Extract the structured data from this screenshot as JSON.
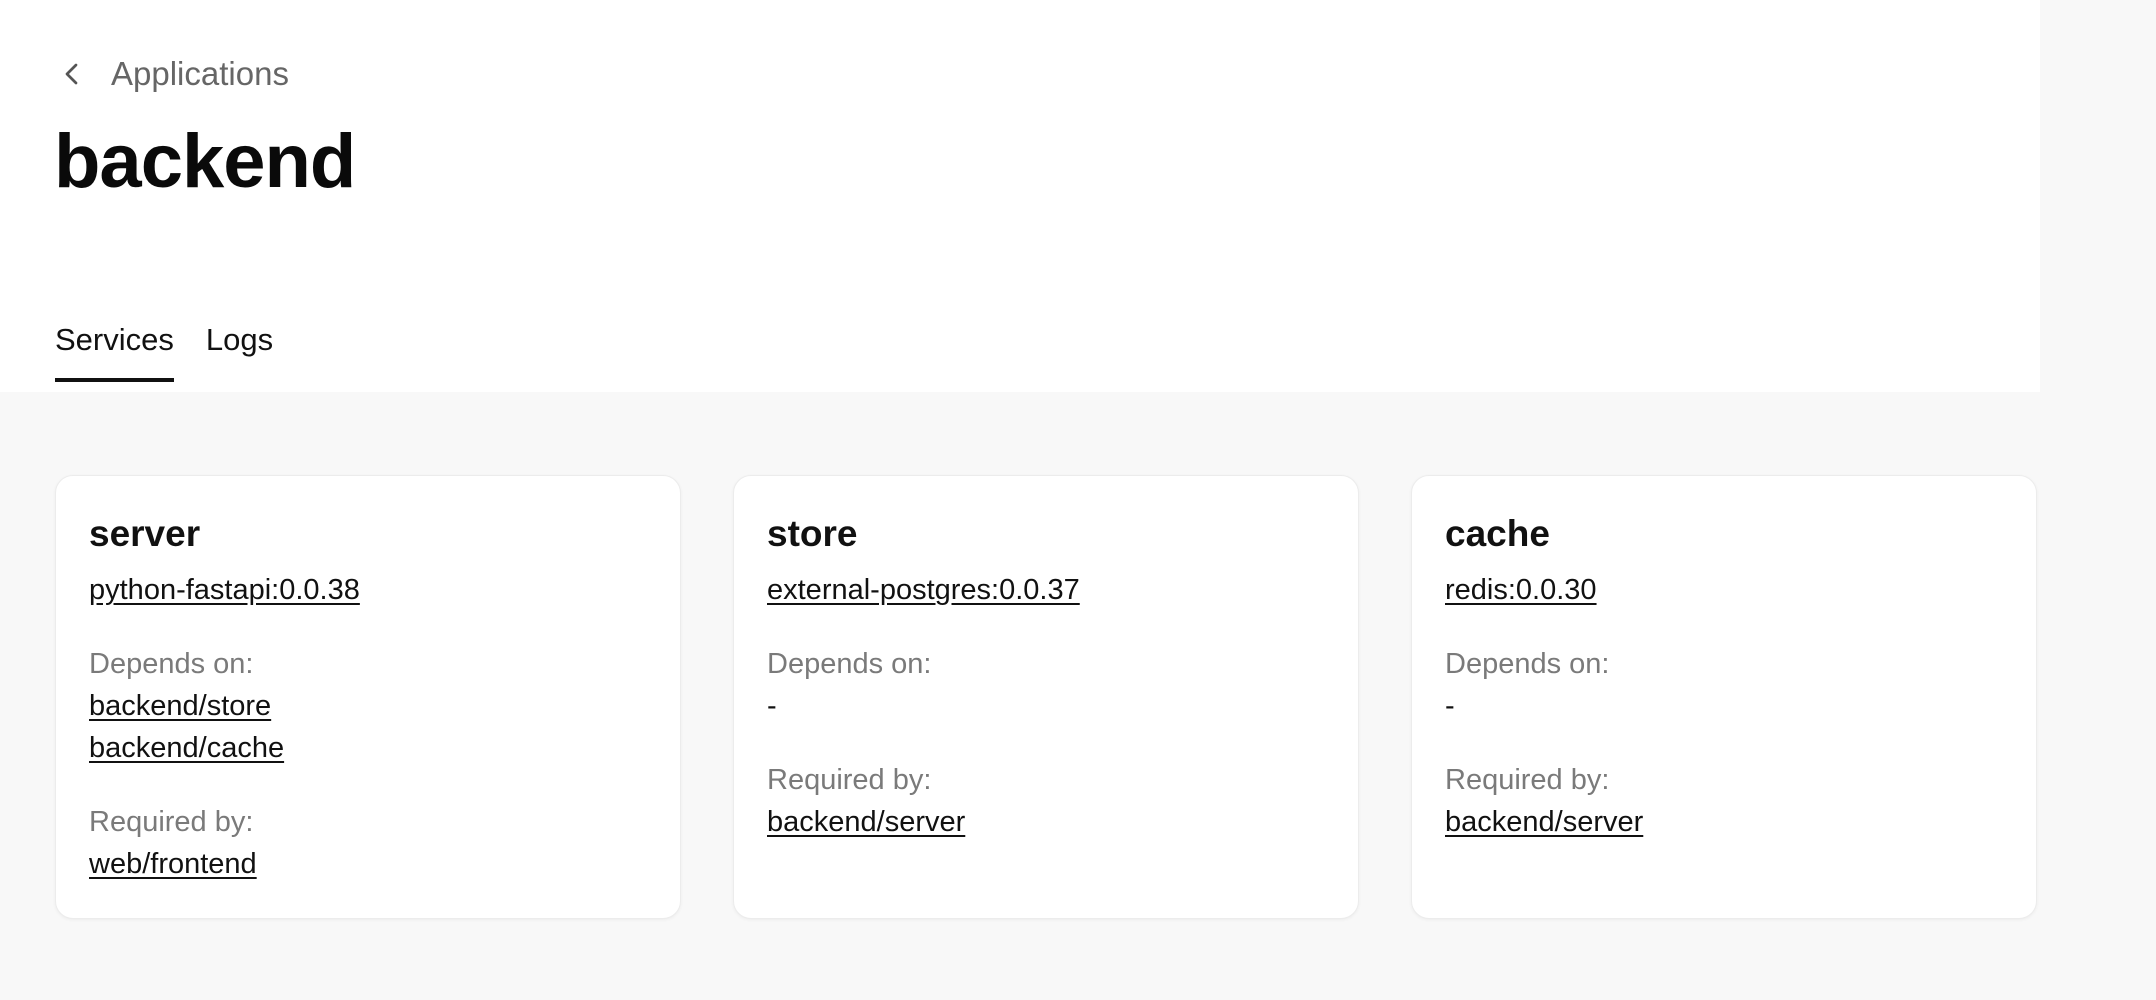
{
  "breadcrumb": {
    "label": "Applications"
  },
  "page": {
    "title": "backend"
  },
  "tabs": [
    {
      "label": "Services",
      "active": true
    },
    {
      "label": "Logs",
      "active": false
    }
  ],
  "labels": {
    "depends_on": "Depends on:",
    "required_by": "Required by:",
    "none": "-"
  },
  "services": [
    {
      "name": "server",
      "image": "python-fastapi:0.0.38",
      "depends_on": [
        "backend/store",
        "backend/cache"
      ],
      "required_by": [
        "web/frontend"
      ]
    },
    {
      "name": "store",
      "image": "external-postgres:0.0.37",
      "depends_on": [],
      "required_by": [
        "backend/server"
      ]
    },
    {
      "name": "cache",
      "image": "redis:0.0.30",
      "depends_on": [],
      "required_by": [
        "backend/server"
      ]
    }
  ],
  "colors": {
    "accent": "#111111",
    "muted_text": "#7a7a7a",
    "page_background": "#f8f8f8"
  },
  "icons": {
    "back": "chevron-left-icon"
  }
}
